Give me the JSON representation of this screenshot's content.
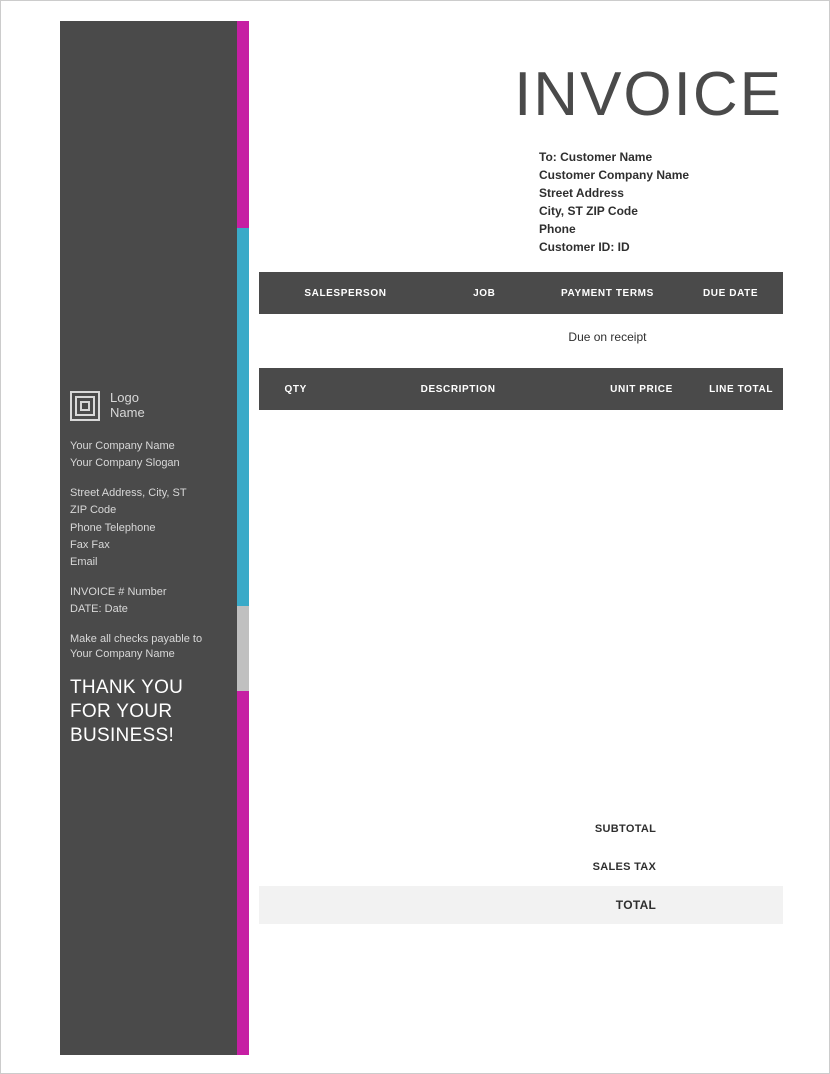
{
  "title": "INVOICE",
  "sidebar": {
    "logo_line1": "Logo",
    "logo_line2": "Name",
    "company_name": "Your Company Name",
    "company_slogan": "Your Company Slogan",
    "address_line1": "Street Address, City, ST",
    "address_line2": "ZIP Code",
    "phone": "Phone Telephone",
    "fax": "Fax Fax",
    "email": "Email",
    "invoice_no": "INVOICE # Number",
    "date": "DATE: Date",
    "payable": "Make all checks payable to Your Company Name",
    "thanks": "THANK YOU FOR YOUR BUSINESS!"
  },
  "customer": {
    "to": "To: Customer Name",
    "company": "Customer Company Name",
    "street": "Street Address",
    "city": "City, ST  ZIP Code",
    "phone": "Phone",
    "id": "Customer ID: ID"
  },
  "details_header": {
    "salesperson": "SALESPERSON",
    "job": "JOB",
    "payment_terms": "PAYMENT TERMS",
    "due_date": "DUE DATE"
  },
  "details_body": {
    "salesperson": "",
    "job": "",
    "payment_terms": "Due on receipt",
    "due_date": ""
  },
  "items_header": {
    "qty": "QTY",
    "description": "DESCRIPTION",
    "unit_price": "UNIT PRICE",
    "line_total": "LINE TOTAL"
  },
  "totals": {
    "subtotal_label": "SUBTOTAL",
    "subtotal_value": "",
    "tax_label": "SALES TAX",
    "tax_value": "",
    "total_label": "TOTAL",
    "total_value": ""
  }
}
